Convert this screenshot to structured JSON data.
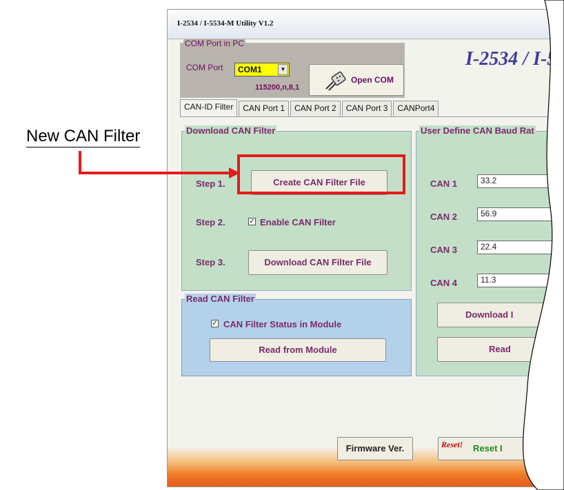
{
  "callout": {
    "label": "New CAN Filter"
  },
  "window": {
    "title": "I-2534 / I-5534-M Utility V1.2"
  },
  "com_group": {
    "legend": "COM Port in PC",
    "label": "COM Port",
    "selected": "COM1",
    "baud": "115200,n,8,1",
    "open_button": "Open COM",
    "product_title": "I-2534 / I-55"
  },
  "tabs": [
    "CAN-ID Filter",
    "CAN Port 1",
    "CAN Port 2",
    "CAN Port 3",
    "CANPort4"
  ],
  "download_filter": {
    "legend": "Download CAN Filter",
    "step1": "Step 1.",
    "step1_button": "Create CAN Filter File",
    "step2": "Step 2.",
    "step2_checkbox": "Enable CAN Filter",
    "step2_checked": true,
    "step3": "Step 3.",
    "step3_button": "Download CAN Filter File"
  },
  "read_filter": {
    "legend": "Read CAN Filter",
    "status_checkbox": "CAN Filter Status in Module",
    "status_checked": true,
    "read_button": "Read from Module"
  },
  "baud_group": {
    "legend": "User Define CAN Baud Rat",
    "ports": [
      {
        "label": "CAN 1",
        "value": "33.2"
      },
      {
        "label": "CAN 2",
        "value": "56.9"
      },
      {
        "label": "CAN 3",
        "value": "22.4"
      },
      {
        "label": "CAN 4",
        "value": "11.3"
      }
    ],
    "download_button": "Download I",
    "read_button": "Read"
  },
  "footer": {
    "firmware_button": "Firmware Ver.",
    "reset_icon_text": "Reset!",
    "reset_button": "Reset I"
  },
  "colors": {
    "highlight": "#e41b1b",
    "title_text": "#3d3d9c",
    "label_text": "#7a2a6a"
  }
}
